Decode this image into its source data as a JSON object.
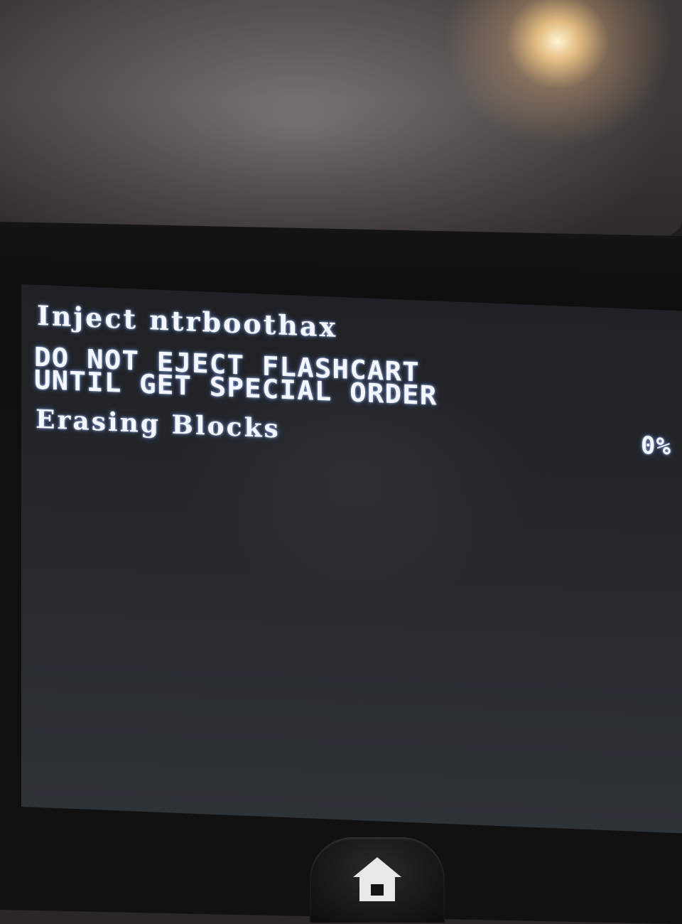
{
  "screen": {
    "title": "Inject ntrboothax",
    "warning_line1": "DO NOT EJECT FLASHCART",
    "warning_line2": "UNTIL GET SPECIAL ORDER",
    "status_label": "Erasing Blocks",
    "progress_text": "0%",
    "progress_percent": 0,
    "text_color": "#f4f7ff",
    "background_color": "#23262a"
  },
  "device": {
    "home_button_icon": "home-icon"
  }
}
